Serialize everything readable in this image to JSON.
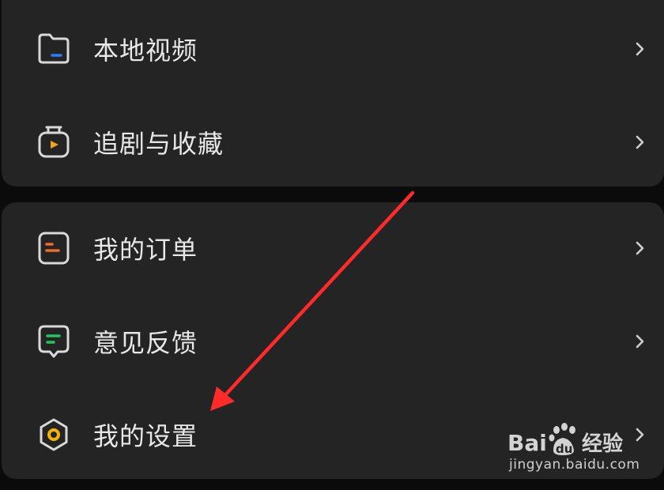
{
  "menu_groups": [
    {
      "items": [
        {
          "label": "本地视频",
          "icon": "folder-icon",
          "accent": "#2f7cf6"
        },
        {
          "label": "追剧与收藏",
          "icon": "tv-play-icon",
          "accent": "#f4a21b"
        }
      ]
    },
    {
      "items": [
        {
          "label": "我的订单",
          "icon": "order-document-icon",
          "accent": "#f06a2a"
        },
        {
          "label": "意见反馈",
          "icon": "feedback-chat-icon",
          "accent": "#22c55e"
        },
        {
          "label": "我的设置",
          "icon": "settings-hexagon-icon",
          "accent": "#f4b400"
        }
      ]
    }
  ],
  "watermark": {
    "brand": "Bai du 经验",
    "url": "jingyan.baidu.com"
  },
  "colors": {
    "background": "#0b0b0b",
    "card": "#242424",
    "text": "#e8e8e8",
    "icon_outline": "#d9d9d9",
    "chevron": "#cfcfcf",
    "annotation_arrow": "#ff2a2a"
  }
}
